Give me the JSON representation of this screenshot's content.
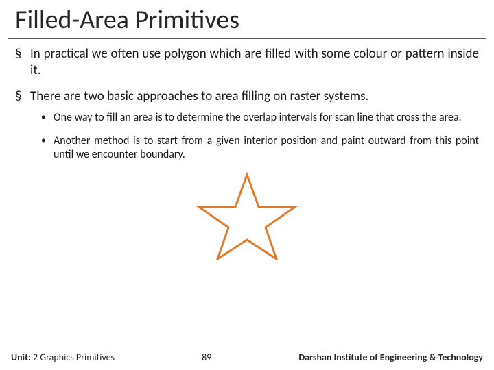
{
  "title": "Filled-Area Primitives",
  "bullets": [
    {
      "text": "In practical we often use polygon which are filled with some colour or pattern inside it."
    },
    {
      "text": "There are two basic approaches to area filling on raster systems.",
      "sub": [
        "One way to fill an area is to determine the overlap intervals for scan line that cross the area.",
        "Another method is to start from a given interior position and paint outward from this point until we encounter boundary."
      ]
    }
  ],
  "figure": {
    "icon": "star-outline",
    "stroke": "#e07b2e"
  },
  "footer": {
    "unit_label": "Unit:",
    "unit_value": "2 Graphics Primitives",
    "page": "89",
    "org": "Darshan Institute of Engineering & Technology"
  }
}
